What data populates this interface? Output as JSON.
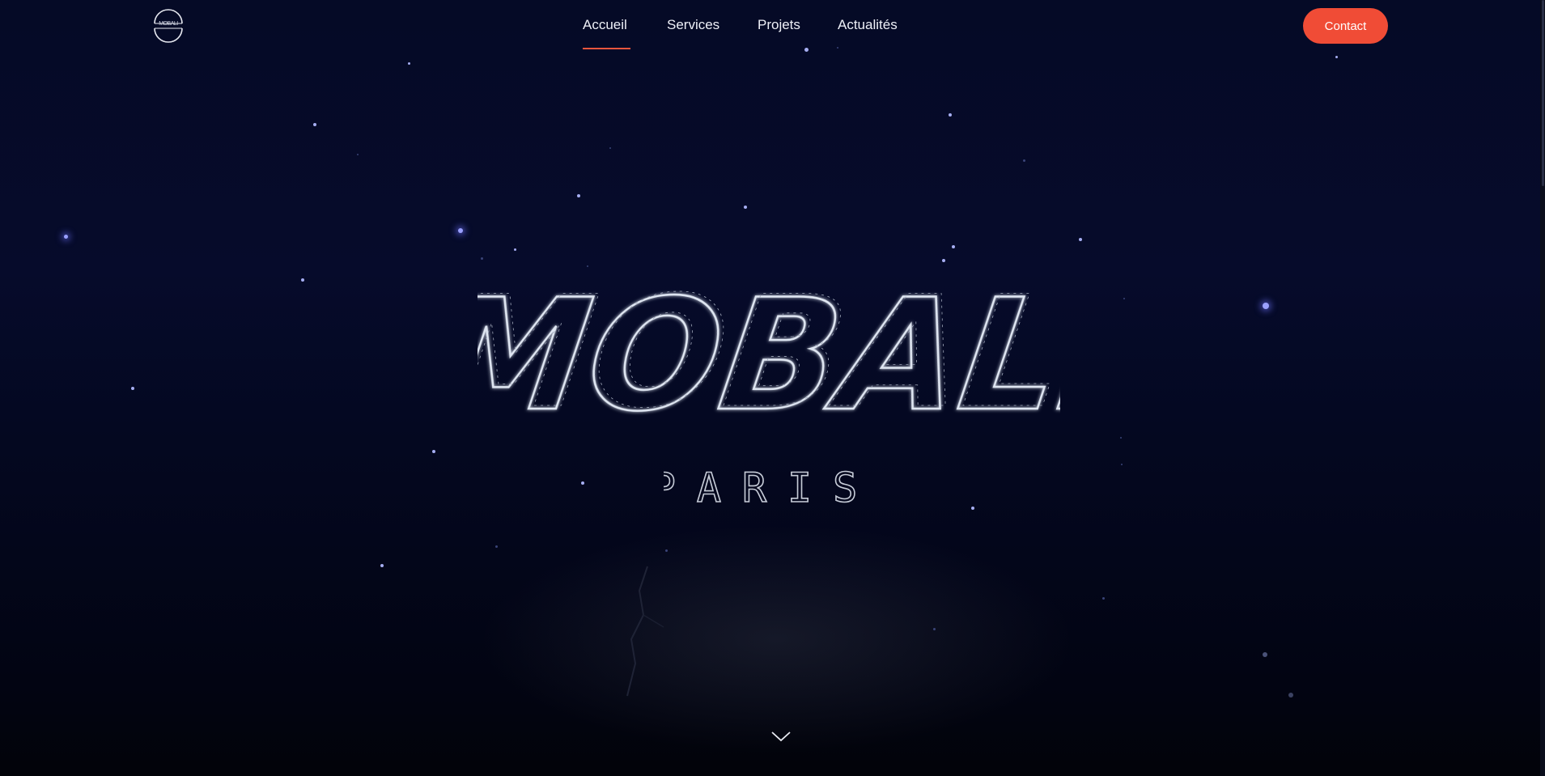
{
  "brand": {
    "logo_text": "MOBALI",
    "hero_title": "MOBALI",
    "hero_subtitle": "PARIS"
  },
  "nav": {
    "items": [
      {
        "label": "Accueil",
        "active": true
      },
      {
        "label": "Services",
        "active": false
      },
      {
        "label": "Projets",
        "active": false
      },
      {
        "label": "Actualités",
        "active": false
      }
    ]
  },
  "header": {
    "contact_label": "Contact"
  },
  "colors": {
    "accent": "#f04c36",
    "background": "#050a26",
    "title_outline": "#dfe6f2"
  },
  "icons": {
    "scroll": "chevron-down-icon",
    "logo": "mobali-logo"
  }
}
